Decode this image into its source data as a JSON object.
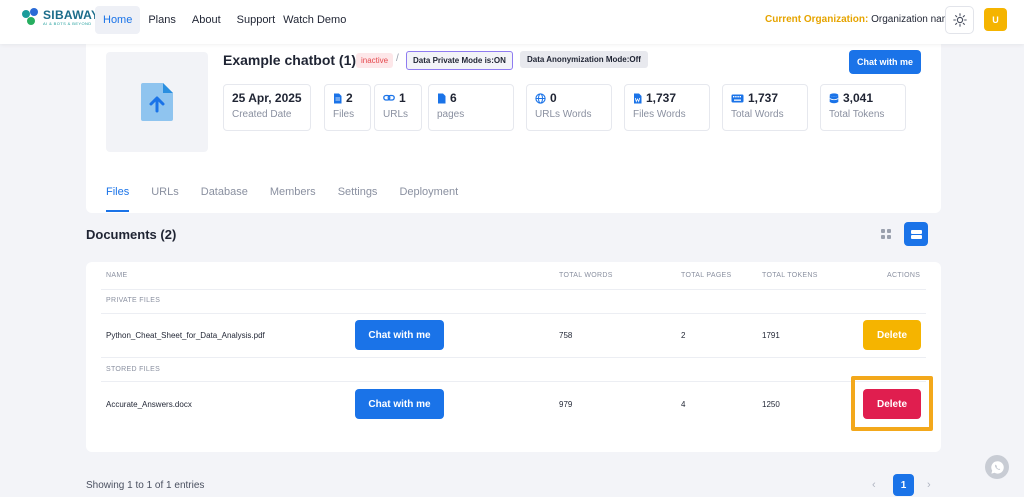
{
  "brand": {
    "name": "SIBAWAY",
    "tagline": "AI & BOTS & BEYOND"
  },
  "nav": {
    "items": [
      "Home",
      "Plans",
      "About",
      "Support",
      "Watch Demo"
    ],
    "active": "Home"
  },
  "org": {
    "label": "Current Organization:",
    "name": "Organization name"
  },
  "user": {
    "initial": "U"
  },
  "bot": {
    "title": "Example chatbot (1)",
    "status": "inactive",
    "separator": "/",
    "private_mode": "Data Private Mode is:ON",
    "anon_mode": "Data Anonymization Mode:Off",
    "chat_label": "Chat with me",
    "stats": [
      {
        "value": "25 Apr, 2025",
        "label": "Created Date"
      },
      {
        "value": "2",
        "label": "Files"
      },
      {
        "value": "1",
        "label": "URLs"
      },
      {
        "value": "6",
        "label": "pages"
      },
      {
        "value": "0",
        "label": "URLs Words"
      },
      {
        "value": "1,737",
        "label": "Files Words"
      },
      {
        "value": "1,737",
        "label": "Total Words"
      },
      {
        "value": "3,041",
        "label": "Total Tokens"
      }
    ]
  },
  "tabs": [
    "Files",
    "URLs",
    "Database",
    "Members",
    "Settings",
    "Deployment"
  ],
  "documents": {
    "title": "Documents (2)",
    "columns": {
      "name": "NAME",
      "words": "TOTAL WORDS",
      "pages": "TOTAL PAGES",
      "tokens": "TOTAL TOKENS",
      "actions": "ACTIONS"
    },
    "groups": [
      "PRIVATE FILES",
      "STORED FILES"
    ],
    "rows": [
      {
        "name": "Python_Cheat_Sheet_for_Data_Analysis.pdf",
        "chat": "Chat with me",
        "words": "758",
        "pages": "2",
        "tokens": "1791",
        "action": "Delete"
      },
      {
        "name": "Accurate_Answers.docx",
        "chat": "Chat with me",
        "words": "979",
        "pages": "4",
        "tokens": "1250",
        "action": "Delete"
      }
    ]
  },
  "footer": {
    "showing": "Showing 1 to 1 of 1 entries",
    "page": "1",
    "prev": "‹",
    "next": "›"
  },
  "colors": {
    "primary": "#1a73e8",
    "warning": "#f5b400",
    "danger": "#e01e4f",
    "highlight": "#f3a81b"
  }
}
